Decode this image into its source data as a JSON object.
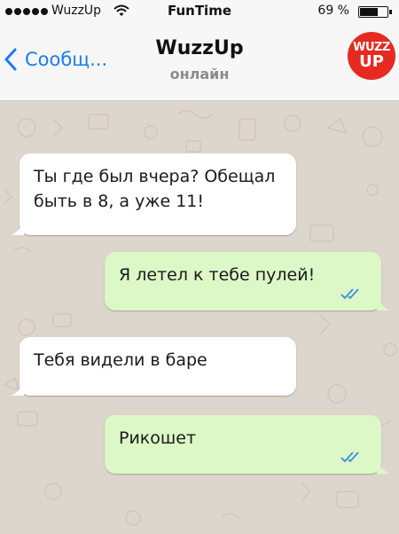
{
  "status_bar": {
    "carrier": "WuzzUp",
    "title": "FunTime",
    "battery_percent": "69 %",
    "battery_level": 0.69
  },
  "header": {
    "back_label": "Сообщ...",
    "title": "WuzzUp",
    "status": "онлайн",
    "avatar_text_top": "WUZZ",
    "avatar_text_bottom": "UP"
  },
  "messages": [
    {
      "direction": "incoming",
      "text": "Ты где был вчера? Обещал быть в 8, а уже 11!"
    },
    {
      "direction": "outgoing",
      "text": "Я летел к тебе пулей!",
      "read": true
    },
    {
      "direction": "incoming",
      "text": "Тебя видели в баре"
    },
    {
      "direction": "outgoing",
      "text": "Рикошет",
      "read": true
    }
  ],
  "colors": {
    "accent": "#1a7cf2",
    "outgoing_bubble": "#dcf8c6",
    "incoming_bubble": "#ffffff",
    "read_check": "#3a8dde",
    "avatar": "#e62a22"
  }
}
